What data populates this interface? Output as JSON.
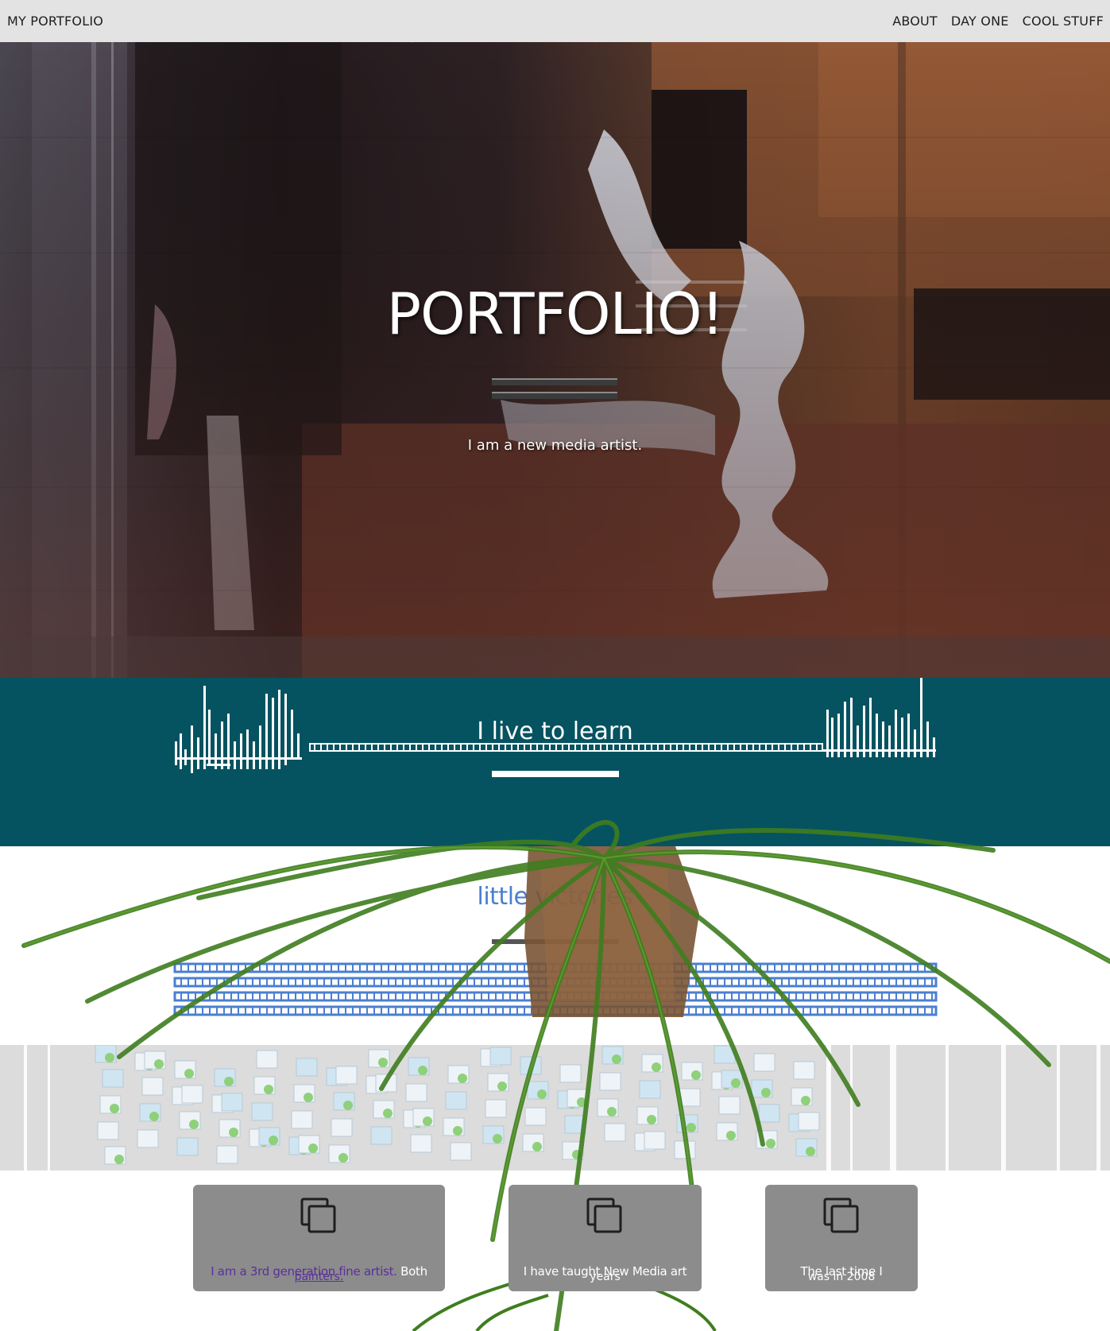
{
  "navbar": {
    "brand": "MY PORTFOLIO",
    "links": [
      "ABOUT",
      "DAY ONE",
      "COOL STUFF"
    ]
  },
  "hero": {
    "title": "PORTFOLIO!",
    "subtitle": "I am a new media artist."
  },
  "learn": {
    "title": "I live to learn"
  },
  "victories": {
    "title": "little victories"
  },
  "cards": [
    {
      "icon": "copy-icon",
      "text_a": "I am a 3rd generation fine artist.",
      "text_b": "Both",
      "text_c": "painters."
    },
    {
      "icon": "copy-icon",
      "text_a": "I have taught New Media art",
      "text_c": "years"
    },
    {
      "icon": "copy-icon",
      "text_a": "The last time I",
      "text_c": "was in 2008"
    }
  ],
  "colors": {
    "navbar_bg": "#e3e3e3",
    "learn_bg": "#055360",
    "victories_title": "#4a7fd0",
    "card_bg": "#8c8c8c",
    "link_purple": "#5b2f9c"
  }
}
